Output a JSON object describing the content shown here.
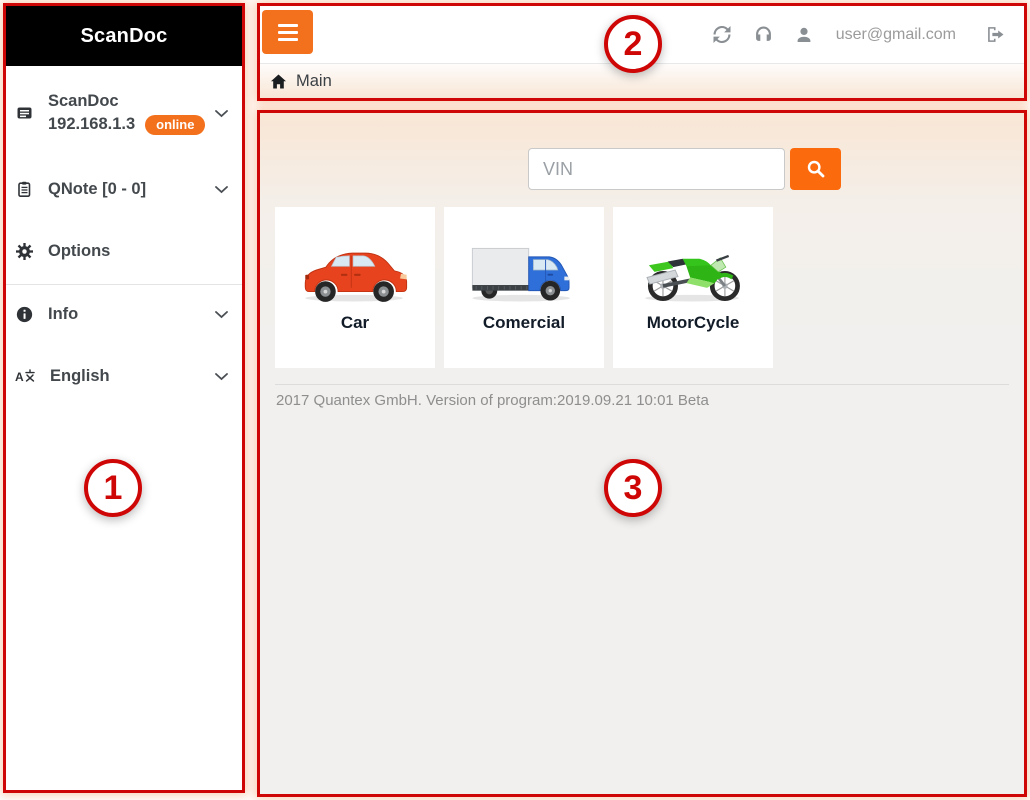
{
  "colors": {
    "accent_orange": "#f3701d",
    "search_button_orange": "#fc6a0e",
    "annotation_red": "#cf0606",
    "sidebar_header_bg": "#000000",
    "online_badge_bg": "#f3701d"
  },
  "annotations": {
    "one": "1",
    "two": "2",
    "three": "3"
  },
  "sidebar": {
    "title": "ScanDoc",
    "items": [
      {
        "icon": "scanner-icon",
        "label": "ScanDoc",
        "address": "192.168.1.3",
        "badge": "online"
      },
      {
        "icon": "qnote-icon",
        "label": "QNote [0 - 0]"
      },
      {
        "icon": "gear-icon",
        "label": "Options"
      },
      {
        "icon": "info-icon",
        "label": "Info"
      },
      {
        "icon": "language-icon",
        "label": "English"
      }
    ]
  },
  "topbar": {
    "email": "user@gmail.com"
  },
  "breadcrumb": {
    "label": "Main"
  },
  "main": {
    "vin_placeholder": "VIN",
    "cards": [
      {
        "label": "Car"
      },
      {
        "label": "Comercial"
      },
      {
        "label": "MotorCycle"
      }
    ],
    "footer": "2017 Quantex GmbH. Version of program:2019.09.21 10:01 Beta"
  }
}
